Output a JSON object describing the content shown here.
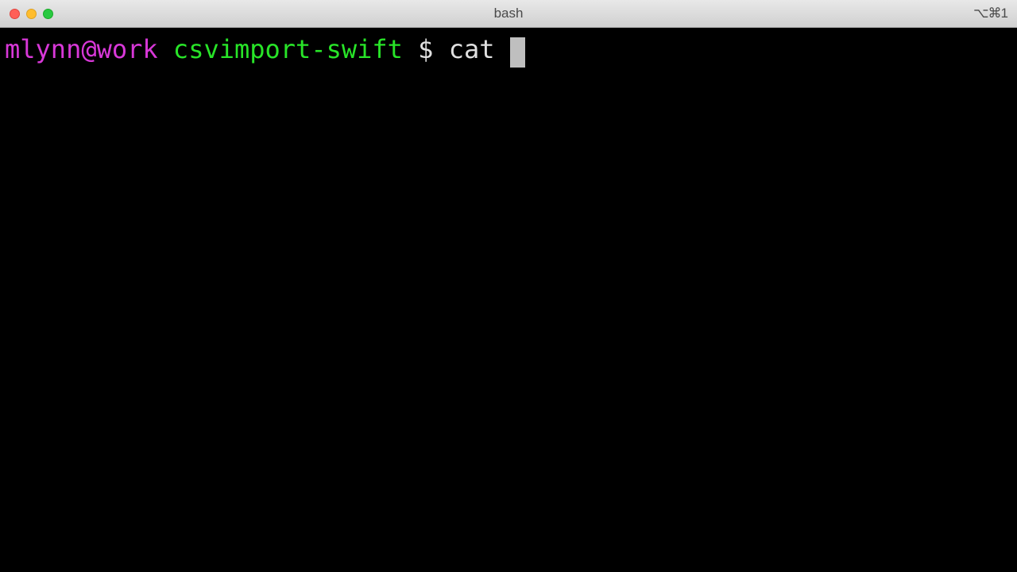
{
  "titlebar": {
    "title": "bash",
    "shortcut_hint": "⌥⌘1"
  },
  "prompt": {
    "user_host": "mlynn@work",
    "directory": "csvimport-swift",
    "symbol": "$",
    "command": "cat "
  }
}
